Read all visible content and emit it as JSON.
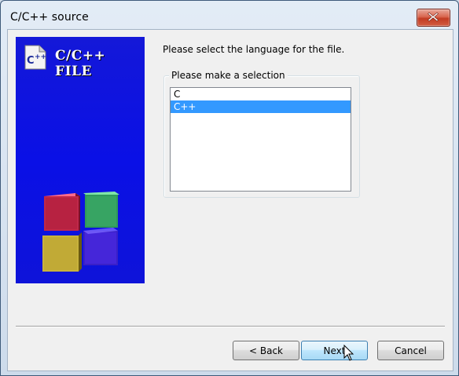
{
  "window": {
    "title": "C/C++ source",
    "close_icon": "close-icon"
  },
  "banner": {
    "title": "C/C++ FILE",
    "logo_icon": "cpp-file-icon",
    "art": "colored-cubes"
  },
  "main": {
    "prompt": "Please select the language for the file.",
    "group_label": "Please make a selection",
    "options": [
      {
        "label": "C",
        "selected": false
      },
      {
        "label": "C++",
        "selected": true
      }
    ]
  },
  "buttons": {
    "back": "< Back",
    "next": "Next",
    "cancel": "Cancel"
  },
  "colors": {
    "selection": "#3399ff",
    "banner": "#0a10e6",
    "close": "#c23c23"
  }
}
